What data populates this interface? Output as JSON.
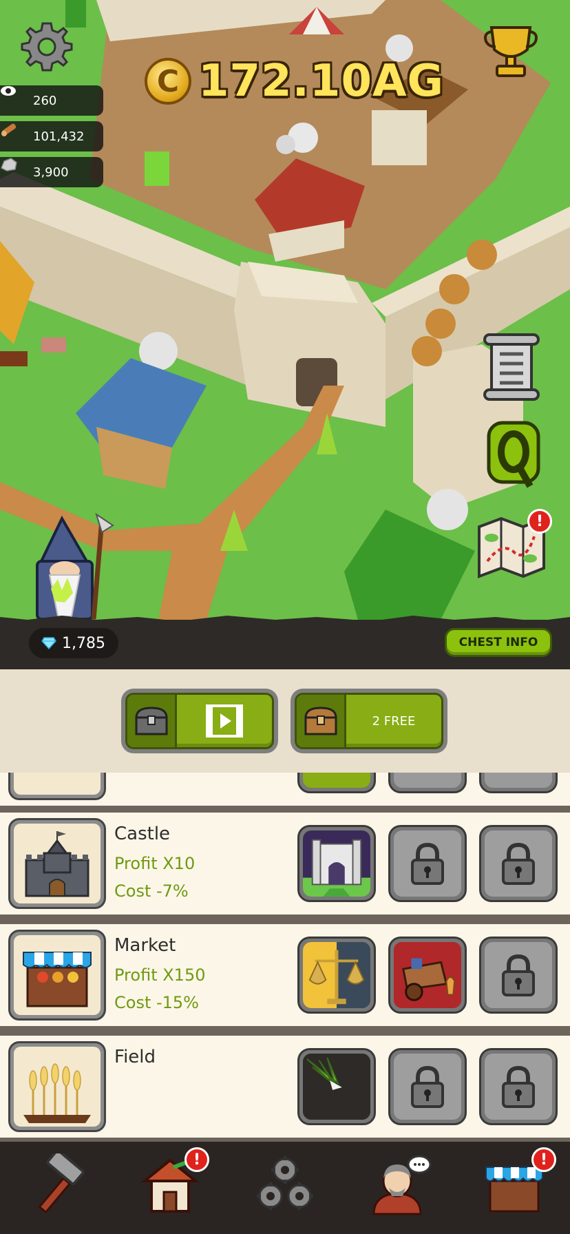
{
  "hud": {
    "stats": [
      {
        "icon": "eye-icon",
        "value": "260"
      },
      {
        "icon": "wood-log-icon",
        "value": "101,432"
      },
      {
        "icon": "stone-icon",
        "value": "3,900"
      }
    ],
    "money": {
      "currency_symbol": "C",
      "amount": "172.10AG"
    },
    "gems": "1,785",
    "chest_info_label": "CHEST INFO"
  },
  "chests": {
    "free_label": "2 FREE"
  },
  "buildings": [
    {
      "name": "Castle",
      "profit": "Profit X10",
      "cost": "Cost -7%",
      "upgrades": [
        "castle-gate-upgrade",
        "locked",
        "locked"
      ]
    },
    {
      "name": "Market",
      "profit": "Profit X150",
      "cost": "Cost -15%",
      "upgrades": [
        "scales-upgrade",
        "merchant-cart-upgrade",
        "locked"
      ]
    },
    {
      "name": "Field",
      "profit": "",
      "cost": "",
      "upgrades": [
        "grass-upgrade",
        "locked",
        "locked"
      ]
    }
  ],
  "nav": {
    "items": [
      "build-hammer-icon",
      "house-icon",
      "gears-icon",
      "advisor-icon",
      "shop-stall-icon"
    ],
    "badge_mark": "!"
  },
  "colors": {
    "accent_green": "#89ad14",
    "gold_text": "#ffe45c",
    "panel_cream": "#fcf6e8",
    "dark_bar": "#2e2a27",
    "notification_red": "#e0221c"
  }
}
